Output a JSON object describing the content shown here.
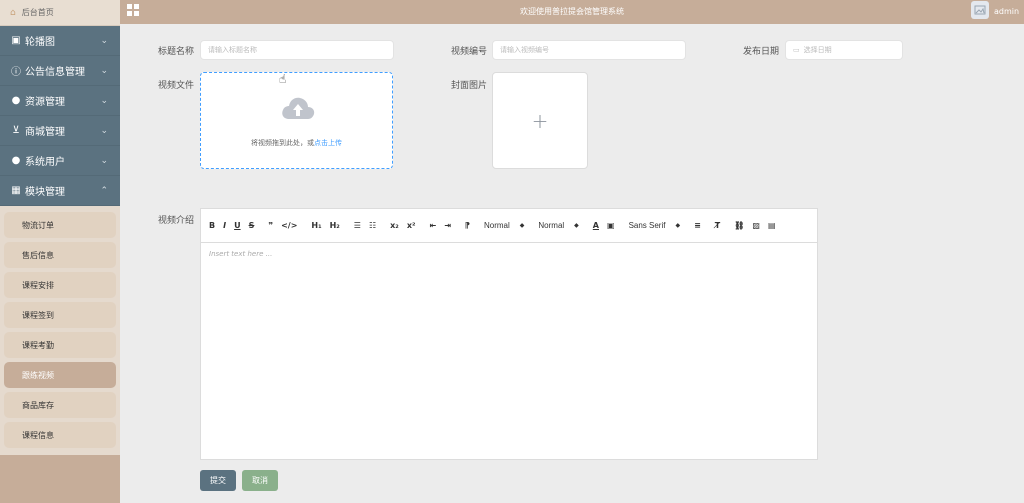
{
  "sidebar": {
    "home_label": "后台首页",
    "menus": [
      {
        "label": "轮播图",
        "icon": "image-icon",
        "glyph": "▣"
      },
      {
        "label": "公告信息管理",
        "icon": "info-circle-icon",
        "glyph": "ⓘ"
      },
      {
        "label": "资源管理",
        "icon": "location-pin-icon",
        "glyph": "●"
      },
      {
        "label": "商城管理",
        "icon": "cart-icon",
        "glyph": "⊻"
      },
      {
        "label": "系统用户",
        "icon": "user-icon",
        "glyph": "●"
      },
      {
        "label": "模块管理",
        "icon": "grid-icon",
        "glyph": "▦"
      }
    ],
    "submenu": [
      "物流订单",
      "售后信息",
      "课程安排",
      "课程签到",
      "课程考勤",
      "跟练视频",
      "商品库存",
      "课程信息"
    ],
    "active_submenu": "跟练视频"
  },
  "header": {
    "title": "欢迎使用普拉提会馆管理系统",
    "user": "admin"
  },
  "form": {
    "title_label": "标题名称",
    "title_placeholder": "请输入标题名称",
    "code_label": "视频编号",
    "code_placeholder": "请输入视频编号",
    "date_label": "发布日期",
    "date_placeholder": "选择日期",
    "video_label": "视频文件",
    "upload_text": "将视频拖到此处，或",
    "upload_link": "点击上传",
    "cover_label": "封面图片",
    "intro_label": "视频介绍",
    "editor_placeholder": "Insert text here ...",
    "editor_toolbar": {
      "header_select": "Normal",
      "size_select": "Normal",
      "font_select": "Sans Serif"
    },
    "submit_label": "提交",
    "cancel_label": "取消"
  },
  "colors": {
    "accent": "#c6ad99",
    "menu": "#5b7280",
    "link": "#409eff",
    "cancel": "#8ab08b"
  }
}
